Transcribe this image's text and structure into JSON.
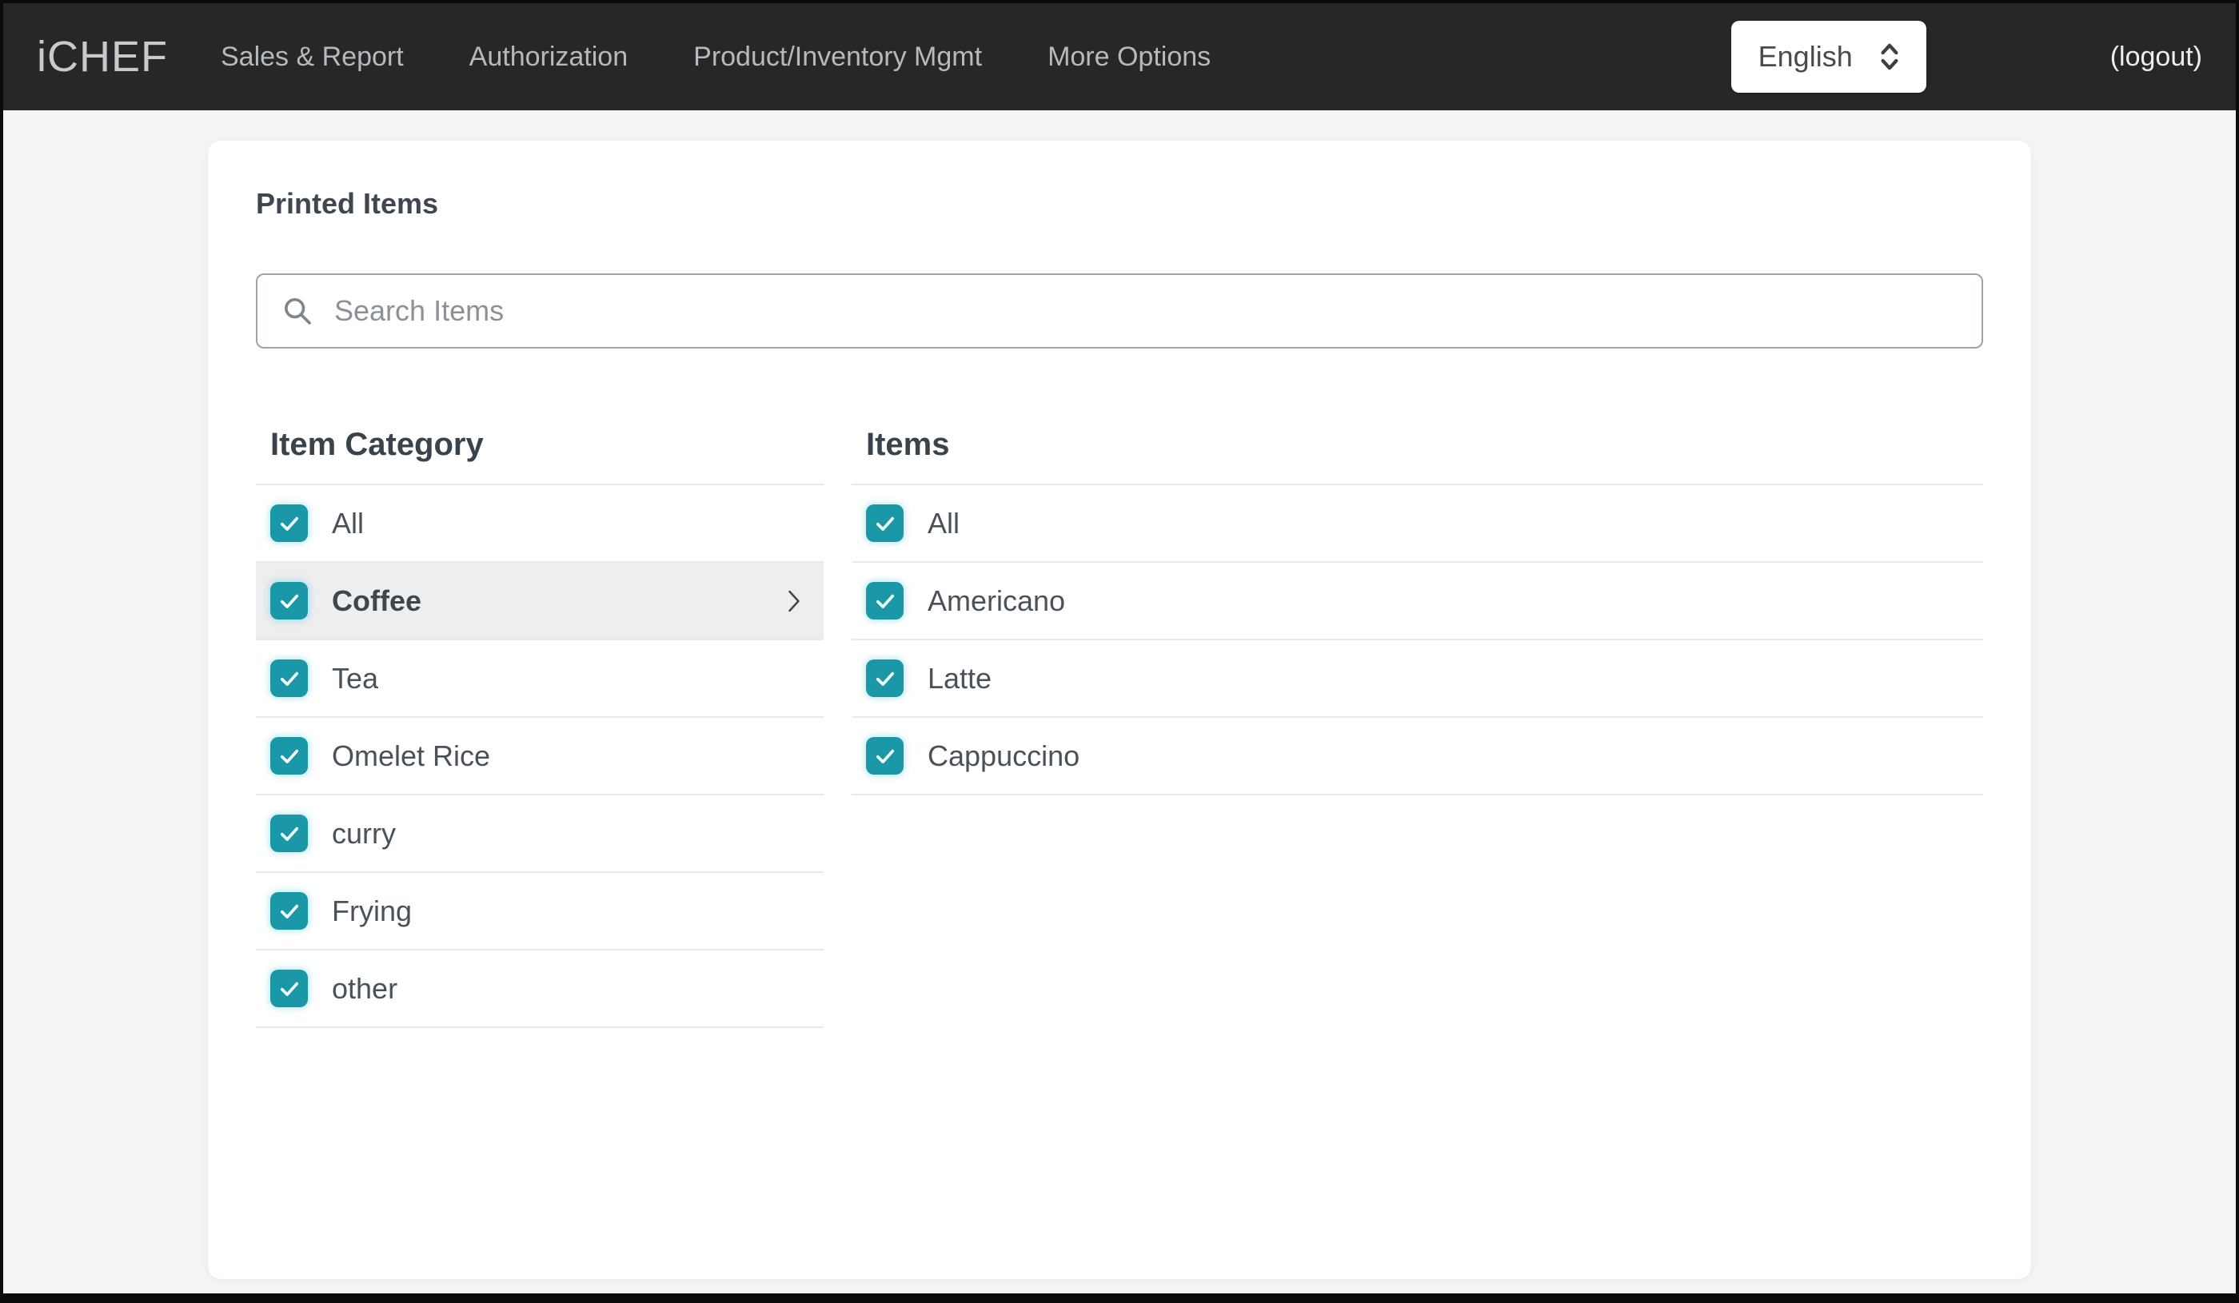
{
  "nav": {
    "brand": "iCHEF",
    "items": [
      {
        "label": "Sales & Report"
      },
      {
        "label": "Authorization"
      },
      {
        "label": "Product/Inventory Mgmt"
      },
      {
        "label": "More Options"
      }
    ],
    "language_select": {
      "value": "English"
    },
    "logout_label": "(logout)"
  },
  "page": {
    "title": "Printed Items",
    "search": {
      "value": "",
      "placeholder": "Search Items"
    },
    "category_column": {
      "header": "Item Category",
      "items": [
        {
          "label": "All",
          "checked": true,
          "selected": false
        },
        {
          "label": "Coffee",
          "checked": true,
          "selected": true,
          "has_chevron": true
        },
        {
          "label": "Tea",
          "checked": true,
          "selected": false
        },
        {
          "label": "Omelet Rice",
          "checked": true,
          "selected": false
        },
        {
          "label": "curry",
          "checked": true,
          "selected": false
        },
        {
          "label": "Frying",
          "checked": true,
          "selected": false
        },
        {
          "label": "other",
          "checked": true,
          "selected": false
        }
      ]
    },
    "items_column": {
      "header": "Items",
      "items": [
        {
          "label": "All",
          "checked": true,
          "selected": false
        },
        {
          "label": "Americano",
          "checked": true,
          "selected": false
        },
        {
          "label": "Latte",
          "checked": true,
          "selected": false
        },
        {
          "label": "Cappuccino",
          "checked": true,
          "selected": false
        }
      ]
    }
  },
  "icons": {
    "search": "magnifier-icon",
    "language_select": "updown-chevrons-icon",
    "selected_row": "chevron-right-icon",
    "checkbox": "checkmark-icon"
  },
  "colors": {
    "accent_teal": "#1A98A8",
    "nav_background": "#272727",
    "nav_text": "#B5BABE",
    "page_background": "#F3F4F6",
    "card_background": "#FFFFFF",
    "selected_row_background": "#EDEEEF",
    "divider": "#E7E9EB",
    "text_primary": "#39434B",
    "text_secondary": "#49525A"
  }
}
